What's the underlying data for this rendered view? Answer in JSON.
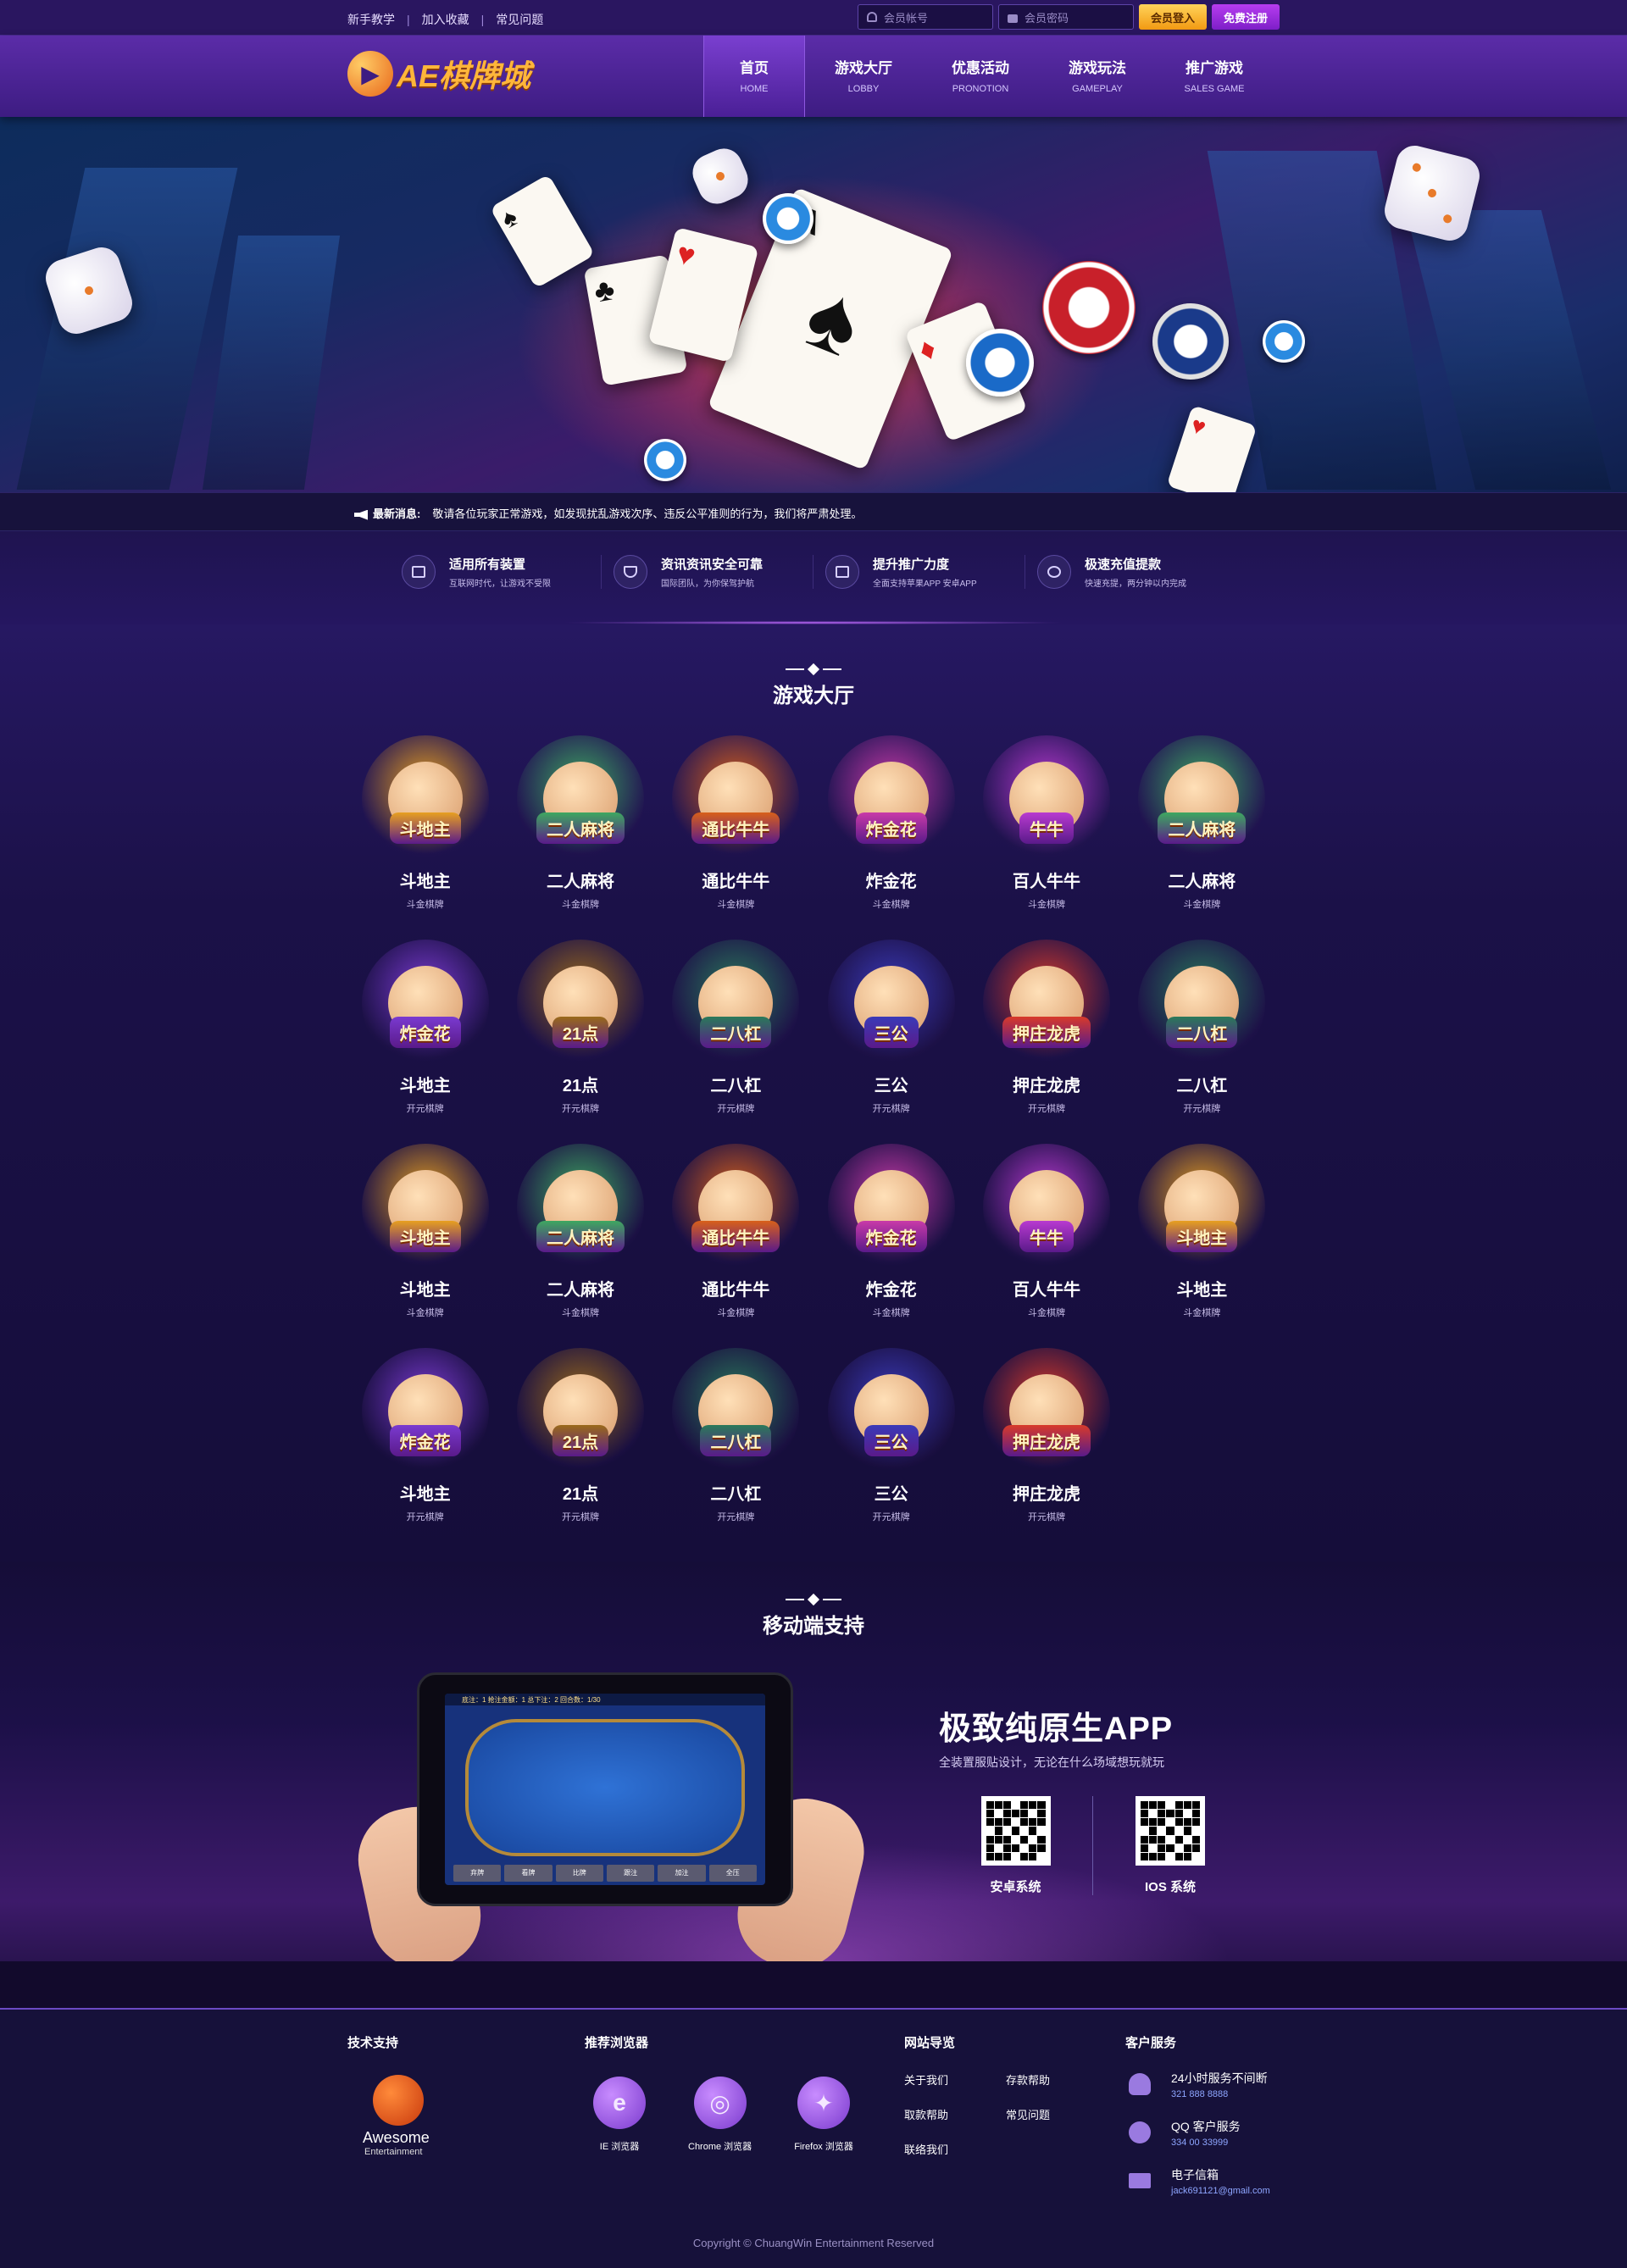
{
  "topbar": {
    "links": [
      "新手教学",
      "加入收藏",
      "常见问题"
    ],
    "username_placeholder": "会员帐号",
    "password_placeholder": "会员密码",
    "login_label": "会员登入",
    "register_label": "免费注册"
  },
  "header": {
    "logo_text": "AE棋牌城",
    "nav": [
      {
        "cn": "首页",
        "en": "HOME",
        "active": true
      },
      {
        "cn": "游戏大厅",
        "en": "LOBBY"
      },
      {
        "cn": "优惠活动",
        "en": "PRONOTION"
      },
      {
        "cn": "游戏玩法",
        "en": "GAMEPLAY"
      },
      {
        "cn": "推广游戏",
        "en": "SALES GAME"
      }
    ]
  },
  "ticker": {
    "label": "最新消息:",
    "text": "敬请各位玩家正常游戏，如发现扰乱游戏次序、违反公平准则的行为，我们将严肃处理。"
  },
  "features": [
    {
      "title": "适用所有装置",
      "sub": "互联网时代，让游戏不受限",
      "icon": "devices-icon"
    },
    {
      "title": "资讯资讯安全可靠",
      "sub": "国际团队，为你保驾护航",
      "icon": "shield-icon"
    },
    {
      "title": "提升推广力度",
      "sub": "全面支持苹果APP 安卓APP",
      "icon": "chart-icon"
    },
    {
      "title": "极速充值提款",
      "sub": "快速充提，两分钟以内完成",
      "icon": "dollar-icon"
    }
  ],
  "lobby": {
    "title": "游戏大厅",
    "games": [
      {
        "name": "斗地主",
        "sub": "斗金棋牌",
        "badge": "斗地主",
        "color": "#e8a020"
      },
      {
        "name": "二人麻将",
        "sub": "斗金棋牌",
        "badge": "二人麻将",
        "color": "#3ea860"
      },
      {
        "name": "通比牛牛",
        "sub": "斗金棋牌",
        "badge": "通比牛牛",
        "color": "#d8601a"
      },
      {
        "name": "炸金花",
        "sub": "斗金棋牌",
        "badge": "炸金花",
        "color": "#c83aa8"
      },
      {
        "name": "百人牛牛",
        "sub": "斗金棋牌",
        "badge": "牛牛",
        "color": "#b83ad0"
      },
      {
        "name": "二人麻将",
        "sub": "斗金棋牌",
        "badge": "二人麻将",
        "color": "#3ea860"
      },
      {
        "name": "斗地主",
        "sub": "开元棋牌",
        "badge": "炸金花",
        "color": "#7a3ad0"
      },
      {
        "name": "21点",
        "sub": "开元棋牌",
        "badge": "21点",
        "color": "#9a6a1a"
      },
      {
        "name": "二八杠",
        "sub": "开元棋牌",
        "badge": "二八杠",
        "color": "#2a7a5a"
      },
      {
        "name": "三公",
        "sub": "开元棋牌",
        "badge": "三公",
        "color": "#3a3ab8"
      },
      {
        "name": "押庄龙虎",
        "sub": "开元棋牌",
        "badge": "押庄龙虎",
        "color": "#d83a2a"
      },
      {
        "name": "二八杠",
        "sub": "开元棋牌",
        "badge": "二八杠",
        "color": "#2a7a5a"
      },
      {
        "name": "斗地主",
        "sub": "斗金棋牌",
        "badge": "斗地主",
        "color": "#e8a020"
      },
      {
        "name": "二人麻将",
        "sub": "斗金棋牌",
        "badge": "二人麻将",
        "color": "#3ea860"
      },
      {
        "name": "通比牛牛",
        "sub": "斗金棋牌",
        "badge": "通比牛牛",
        "color": "#d8601a"
      },
      {
        "name": "炸金花",
        "sub": "斗金棋牌",
        "badge": "炸金花",
        "color": "#c83aa8"
      },
      {
        "name": "百人牛牛",
        "sub": "斗金棋牌",
        "badge": "牛牛",
        "color": "#b83ad0"
      },
      {
        "name": "斗地主",
        "sub": "斗金棋牌",
        "badge": "斗地主",
        "color": "#e8a020"
      },
      {
        "name": "斗地主",
        "sub": "开元棋牌",
        "badge": "炸金花",
        "color": "#7a3ad0"
      },
      {
        "name": "21点",
        "sub": "开元棋牌",
        "badge": "21点",
        "color": "#9a6a1a"
      },
      {
        "name": "二八杠",
        "sub": "开元棋牌",
        "badge": "二八杠",
        "color": "#2a7a5a"
      },
      {
        "name": "三公",
        "sub": "开元棋牌",
        "badge": "三公",
        "color": "#3a3ab8"
      },
      {
        "name": "押庄龙虎",
        "sub": "开元棋牌",
        "badge": "押庄龙虎",
        "color": "#d83a2a"
      }
    ]
  },
  "mobile": {
    "title": "移动端支持",
    "headline": "极致纯原生APP",
    "sub": "全装置服贴设计，无论在什么场域想玩就玩",
    "qr_android": "安卓系统",
    "qr_ios": "IOS 系统",
    "hud": "底注：1   抢注金额：1   总下注：2   回合数：1/30",
    "bar": [
      "弃牌",
      "看牌",
      "比牌",
      "跟注",
      "加注",
      "全压"
    ]
  },
  "footer": {
    "tech_title": "技术支持",
    "tech_name": "Awesome",
    "tech_sub": "Entertainment",
    "browsers_title": "推荐浏览器",
    "browsers": [
      {
        "label": "IE 浏览器",
        "glyph": "e"
      },
      {
        "label": "Chrome 浏览器",
        "glyph": "◎"
      },
      {
        "label": "Firefox 浏览器",
        "glyph": "✦"
      }
    ],
    "nav_title": "网站导览",
    "nav_links": [
      "关于我们",
      "存款帮助",
      "取款帮助",
      "常见问题",
      "联络我们"
    ],
    "service_title": "客户服务",
    "services": [
      {
        "title": "24小时服务不间断",
        "sub": "321 888 8888",
        "icon": "headset-icon"
      },
      {
        "title": "QQ 客户服务",
        "sub": "334 00 33999",
        "icon": "qq-icon"
      },
      {
        "title": "电子信箱",
        "sub": "jack691121@gmail.com",
        "icon": "mail-icon"
      }
    ],
    "copyright": "Copyright © ChuangWin Entertainment Reserved"
  }
}
